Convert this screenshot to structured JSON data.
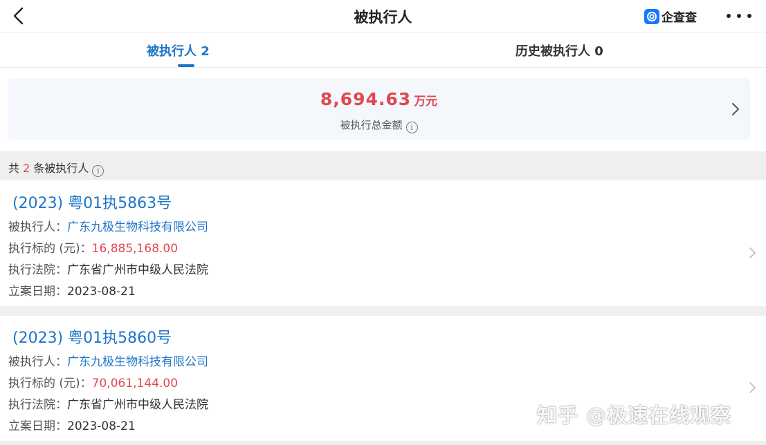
{
  "header": {
    "title": "被执行人",
    "brand": "企查查"
  },
  "tabs": [
    {
      "label": "被执行人 2",
      "active": true
    },
    {
      "label": "历史被执行人 0",
      "active": false
    }
  ],
  "summary": {
    "amount": "8,694.63",
    "unit": "万元",
    "label": "被执行总金额"
  },
  "count_bar": {
    "prefix": "共 ",
    "count": "2",
    "suffix": " 条被执行人"
  },
  "field_labels": {
    "executed_person": "被执行人：",
    "target": "执行标的 (元)：",
    "court": "执行法院：",
    "filing_date": "立案日期："
  },
  "records": [
    {
      "case_no": "(2023) 粤01执5863号",
      "executed_person": "广东九极生物科技有限公司",
      "target": "16,885,168.00",
      "court": "广东省广州市中级人民法院",
      "filing_date": "2023-08-21"
    },
    {
      "case_no": "(2023) 粤01执5860号",
      "executed_person": "广东九极生物科技有限公司",
      "target": "70,061,144.00",
      "court": "广东省广州市中级人民法院",
      "filing_date": "2023-08-21"
    }
  ],
  "watermark": "知乎 @极速在线观察",
  "colors": {
    "accent_blue": "#1e74c9",
    "amount_red": "#e0484f",
    "summary_bg": "#f4f7fc",
    "separator_bg": "#efefef"
  },
  "icons": [
    "back-icon",
    "brand-logo-icon",
    "more-icon",
    "info-icon",
    "chevron-right-icon"
  ]
}
